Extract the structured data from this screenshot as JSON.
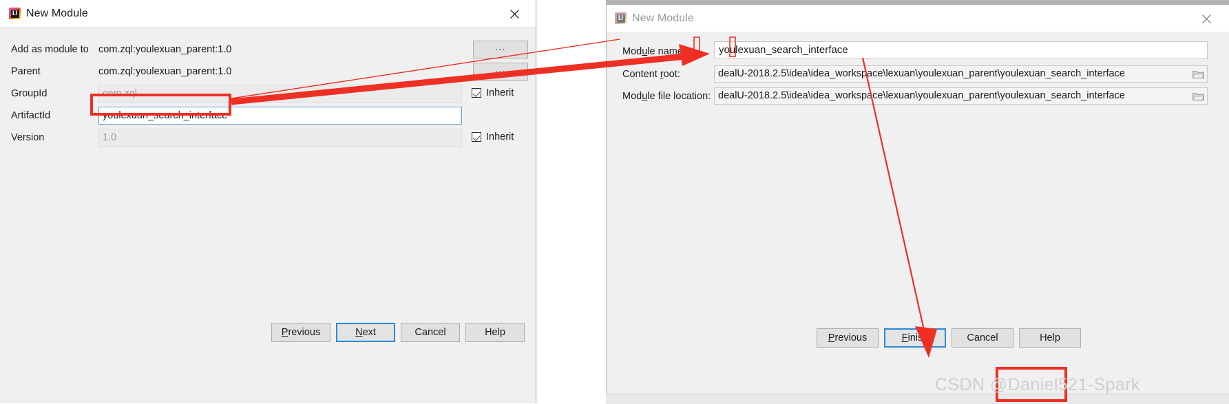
{
  "left_dialog": {
    "title": "New Module",
    "icon": "intellij-idea-icon",
    "close_icon": "close-icon",
    "fields": [
      {
        "label": "Add as module to",
        "value": "com.zql:youlexuan_parent:1.0",
        "type": "static",
        "browse_label": "..."
      },
      {
        "label": "Parent",
        "value": "com.zql:youlexuan_parent:1.0",
        "type": "static",
        "browse_label": "..."
      },
      {
        "label": "GroupId",
        "value": "com.zql",
        "type": "text-disabled",
        "inherit_label": "Inherit"
      },
      {
        "label": "ArtifactId",
        "value": "youlexuan_search_interface",
        "type": "text-focused"
      },
      {
        "label": "Version",
        "value": "1.0",
        "type": "text-disabled",
        "inherit_label": "Inherit"
      }
    ],
    "buttons": [
      {
        "label": "Previous",
        "mnemonic": "P",
        "default": false
      },
      {
        "label": "Next",
        "mnemonic": "N",
        "default": true
      },
      {
        "label": "Cancel",
        "mnemonic": "",
        "default": false
      },
      {
        "label": "Help",
        "mnemonic": "",
        "default": false
      }
    ]
  },
  "right_dialog": {
    "title": "New Module",
    "icon": "intellij-idea-icon",
    "close_icon": "close-icon",
    "active": false,
    "fields": [
      {
        "label": "Module name:",
        "mnemonic": "m",
        "value": "youlexuan_search_interface",
        "type": "name"
      },
      {
        "label": "Content root:",
        "mnemonic": "r",
        "value": "dealU-2018.2.5\\idea\\idea_workspace\\lexuan\\youlexuan_parent\\youlexuan_search_interface",
        "type": "path",
        "browse_icon": "folder-icon"
      },
      {
        "label": "Module file location:",
        "mnemonic": "u",
        "value": "dealU-2018.2.5\\idea\\idea_workspace\\lexuan\\youlexuan_parent\\youlexuan_search_interface",
        "type": "path",
        "browse_icon": "folder-icon"
      }
    ],
    "buttons": [
      {
        "label": "Previous",
        "mnemonic": "P",
        "default": false,
        "highlighted": false
      },
      {
        "label": "Finish",
        "mnemonic": "F",
        "default": true,
        "highlighted": true
      },
      {
        "label": "Cancel",
        "mnemonic": "",
        "default": false,
        "highlighted": false
      },
      {
        "label": "Help",
        "mnemonic": "",
        "default": false,
        "highlighted": false
      }
    ]
  },
  "annotations": {
    "accent_color": "#ee2f24",
    "thick_arrow_label": "artifactid-to-module-name-arrow",
    "thin_line_label": "module-name-to-finish-arrow",
    "highlight_boxes": [
      "artifactid-field-highlight",
      "module-name-underscore-1-highlight",
      "module-name-underscore-2-highlight",
      "finish-button-highlight"
    ]
  },
  "watermark": {
    "text": "CSDN @Daniel521-Spark"
  }
}
